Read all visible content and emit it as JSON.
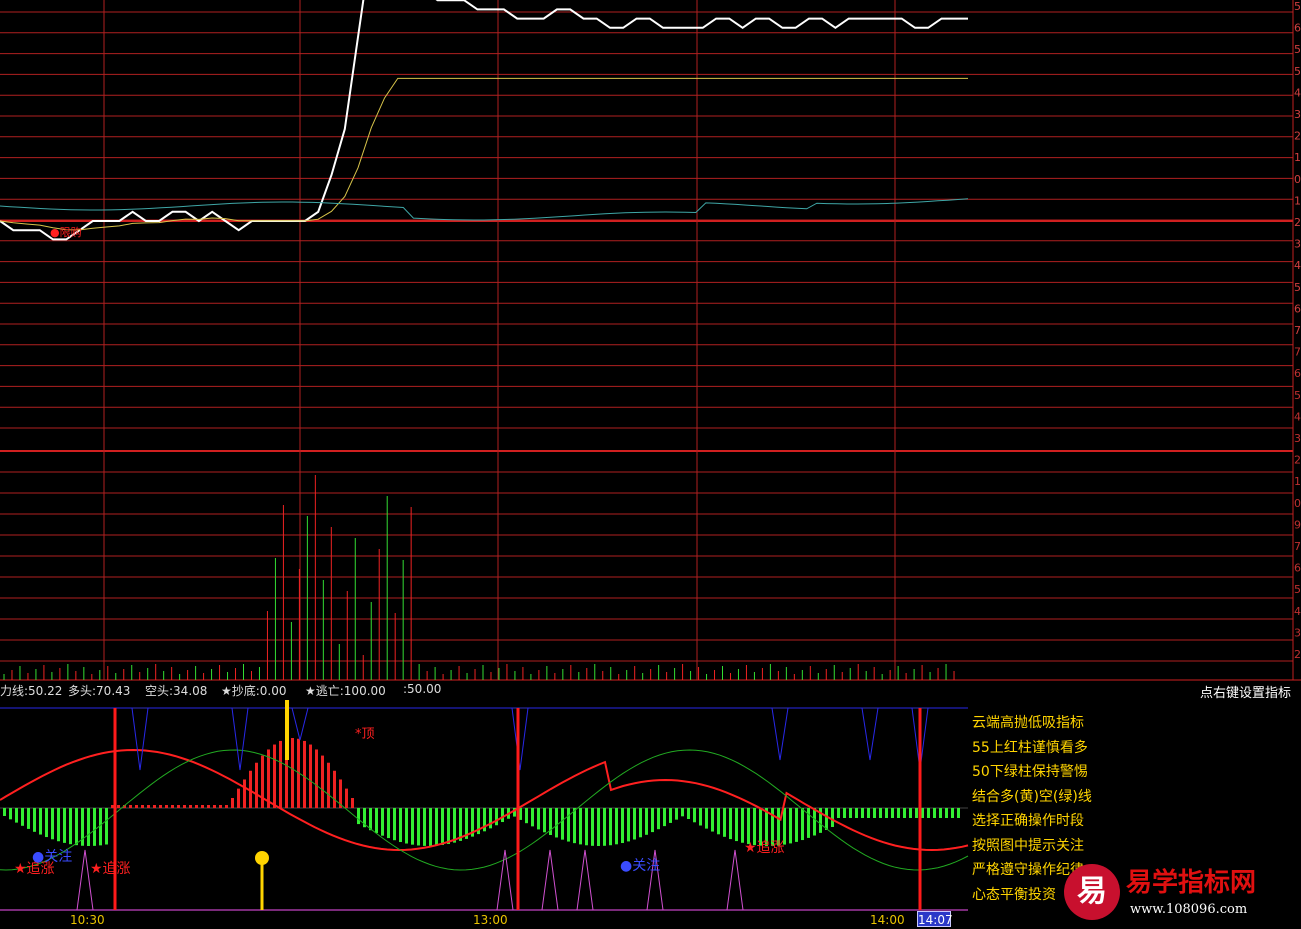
{
  "colors": {
    "background": "#000000",
    "grid": "#b02020",
    "price_line": "#ffffff",
    "avg_line": "#d8c44a",
    "cyan_line": "#3fa6a6",
    "red_curve": "#ff2020",
    "green_curve": "#22aa22",
    "blue_line": "#2828e8",
    "magenta": "#d050d0",
    "yellow": "#ffd400",
    "green_bar": "#33ee33",
    "red_bar": "#ee2222"
  },
  "info_bar": {
    "power_line": "力线:50.22",
    "bulls": "多头:70.43",
    "bears": "空头:34.08",
    "bottom": "★抄底:0.00",
    "escape": "★逃亡:100.00",
    "level": ":50.00",
    "settings_hint": "点右键设置指标"
  },
  "indicator_hints": [
    "云端高抛低吸指标",
    "55上红柱谨慎看多",
    "50下绿柱保持警惕",
    "结合多(黄)空(绿)线",
    "选择正确操作时段",
    "按照图中提示关注",
    "严格遵守操作纪律",
    "心态平衡投资"
  ],
  "annotations": {
    "chase1": "★追涨",
    "chase2": "★追涨",
    "chase3": "★追涨",
    "watch1": "●关注",
    "watch2": "●关注",
    "top": "*顶",
    "price_tag": "●限购"
  },
  "time_axis": {
    "t1": "10:30",
    "t2": "13:00",
    "t3": "14:00",
    "cursor": "14:07"
  },
  "right_axis_digits": [
    "5",
    "6",
    "5",
    "5",
    "4",
    "3",
    "2",
    "1",
    "0",
    "1",
    "2",
    "3",
    "4",
    "5",
    "6",
    "7",
    "7",
    "6",
    "5",
    "4",
    "3",
    "2",
    "1",
    "0",
    "9",
    "7",
    "6",
    "5",
    "4",
    "3",
    "2"
  ],
  "watermark": {
    "logo_char": "易",
    "title": "易学指标网",
    "url": "www.108096.com"
  },
  "chart_data": {
    "type": "line",
    "price": [
      0,
      -1,
      -1,
      -1,
      -2,
      -2,
      -1,
      0,
      0,
      0,
      1,
      0,
      0,
      1,
      1,
      0,
      1,
      0,
      -1,
      0,
      0,
      0,
      0,
      0,
      1,
      5,
      10,
      20,
      30,
      28,
      26,
      25,
      25,
      24,
      24,
      24,
      23,
      23,
      23,
      22,
      22,
      22,
      23,
      23,
      22,
      22,
      21,
      21,
      22,
      22,
      21,
      21,
      21,
      21,
      22,
      22,
      21,
      22,
      22,
      21,
      21,
      22,
      22,
      21,
      22,
      22,
      22,
      22,
      22,
      21,
      21,
      22,
      22,
      22
    ]
  }
}
